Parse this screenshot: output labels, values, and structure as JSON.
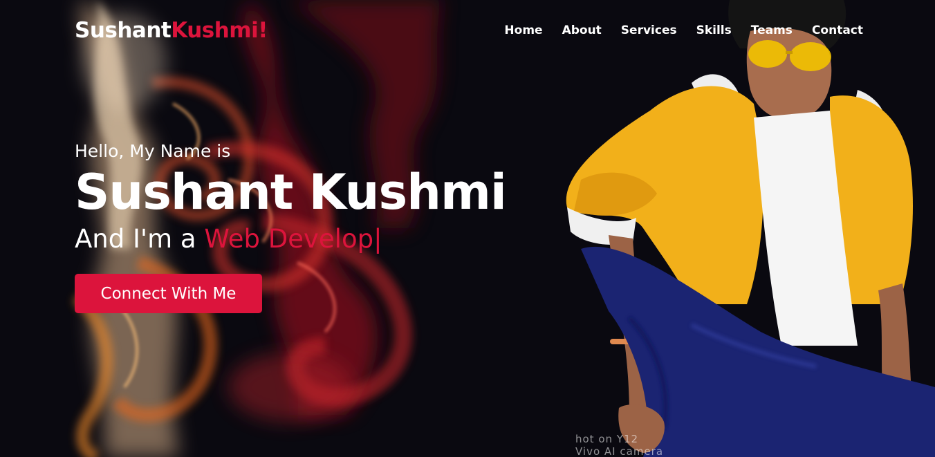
{
  "brand": {
    "first": "Sushant",
    "second": "Kushmi!"
  },
  "nav": {
    "items": [
      "Home",
      "About",
      "Services",
      "Skills",
      "Teams",
      "Contact"
    ]
  },
  "hero": {
    "greeting": "Hello, My Name is",
    "name": "Sushant Kushmi",
    "role_prefix": "And I'm a",
    "role_typed": "Web Develop",
    "cursor": "|",
    "cta_label": "Connect With Me"
  },
  "photo_watermark": {
    "line1": "hot on Y12",
    "line2": "Vivo AI camera"
  },
  "colors": {
    "accent": "#dc143c",
    "background": "#0a0910",
    "text": "#ffffff",
    "jacket": "#f4b400",
    "jeans": "#1f2a78"
  }
}
